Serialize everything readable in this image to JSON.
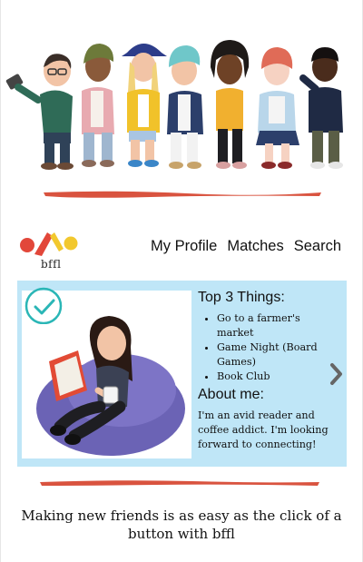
{
  "hero": {
    "icon": "bitmoji-friends-illustration"
  },
  "brand": {
    "name": "bffl",
    "colors": {
      "red": "#e2473a",
      "yellow": "#f2c82e",
      "accent_brush": "#d9533f"
    }
  },
  "nav": {
    "items": [
      {
        "label": "My Profile"
      },
      {
        "label": "Matches"
      },
      {
        "label": "Search"
      }
    ]
  },
  "profile_card": {
    "background": "#bfe6f7",
    "check_icon": "check-circle-icon",
    "top3_heading": "Top 3 Things:",
    "top3": [
      "Go to a farmer's market",
      "Game Night (Board Games)",
      "Book Club"
    ],
    "about_heading": "About me:",
    "about_text": "I'm an avid reader and coffee addict. I'm looking forward to connecting!",
    "next_icon": "chevron-right-icon"
  },
  "tagline": "Making new friends is as easy as the click of a button with bffl"
}
